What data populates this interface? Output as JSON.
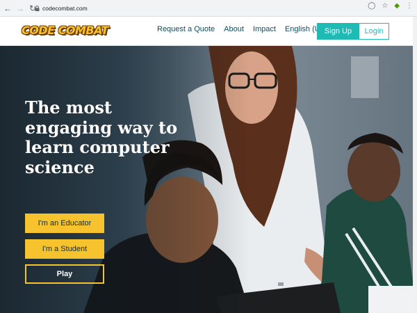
{
  "browser": {
    "url": "codecombat.com",
    "icons": [
      "back-icon",
      "forward-icon",
      "reload-icon",
      "lock-icon",
      "zoom-icon",
      "star-icon",
      "extension-icon",
      "menu-icon"
    ]
  },
  "header": {
    "logo_text": "CODE COMBAT",
    "nav": {
      "request_quote": "Request a Quote",
      "about": "About",
      "impact": "Impact",
      "language": "English (US)"
    },
    "signup_label": "Sign Up",
    "login_label": "Login"
  },
  "hero": {
    "headline": "The most engaging way to learn computer science",
    "educator_label": "I'm an Educator",
    "student_label": "I'm a Student",
    "play_label": "Play"
  },
  "colors": {
    "accent_teal": "#1fbab4",
    "cta_yellow": "#f6c22d",
    "nav_text": "#0e4c60"
  }
}
